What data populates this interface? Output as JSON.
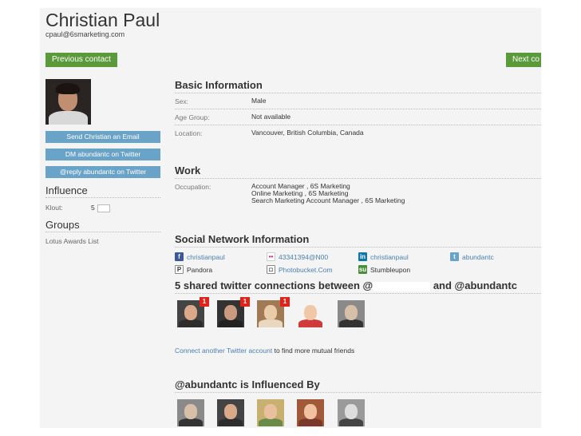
{
  "profile": {
    "name": "Christian Paul",
    "email": "cpaul@6smarketing.com",
    "prev_label": "Previous contact",
    "next_label": "Next co"
  },
  "sidebar": {
    "buttons": [
      "Send Christian an Email",
      "DM abundantc on Twitter",
      "@reply abundantc on Twitter"
    ],
    "influence_title": "Influence",
    "klout_label": "Klout:",
    "klout_value": "5",
    "groups_title": "Groups",
    "groups": [
      "Lotus Awards List"
    ]
  },
  "basic": {
    "title": "Basic Information",
    "rows": [
      {
        "label": "Sex:",
        "value": "Male"
      },
      {
        "label": "Age Group:",
        "value": "Not available"
      },
      {
        "label": "Location:",
        "value": "Vancouver, British Columbia, Canada"
      }
    ]
  },
  "work": {
    "title": "Work",
    "label": "Occupation:",
    "lines": [
      "Account Manager , 6S Marketing",
      "Online Marketing , 6S Marketing",
      "Search Marketing Account Manager , 6S Marketing"
    ]
  },
  "social": {
    "title": "Social Network Information",
    "links": [
      {
        "icon": "facebook-icon",
        "text": "christianpaul",
        "color": "#3b5998"
      },
      {
        "icon": "flickr-icon",
        "text": "43341394@N00",
        "color": "#e11d74"
      },
      {
        "icon": "linkedin-icon",
        "text": "christianpaul",
        "color": "#0e76a8"
      },
      {
        "icon": "twitter-icon",
        "text": "abundantc",
        "color": "#6aa3c8"
      },
      {
        "icon": "pandora-icon",
        "text": "Pandora",
        "color": "#ffffff"
      },
      {
        "icon": "photobucket-icon",
        "text": "Photobucket.Com",
        "color": "#ffffff"
      },
      {
        "icon": "stumbleupon-icon",
        "text": "Stumbleupon",
        "color": "#4a8e3a"
      }
    ]
  },
  "shared": {
    "title_prefix": "5 shared twitter connections between @",
    "title_suffix": "and @abundantc",
    "badges": [
      "1",
      "1",
      "1"
    ],
    "connect_link": "Connect another Twitter account",
    "connect_rest": "to find more mutual friends"
  },
  "influenced": {
    "title": "@abundantc is Influenced By"
  },
  "colors": {
    "green_button": "#5a9a3a",
    "blue_button": "#6aa3c8",
    "link": "#4a7fb0"
  }
}
